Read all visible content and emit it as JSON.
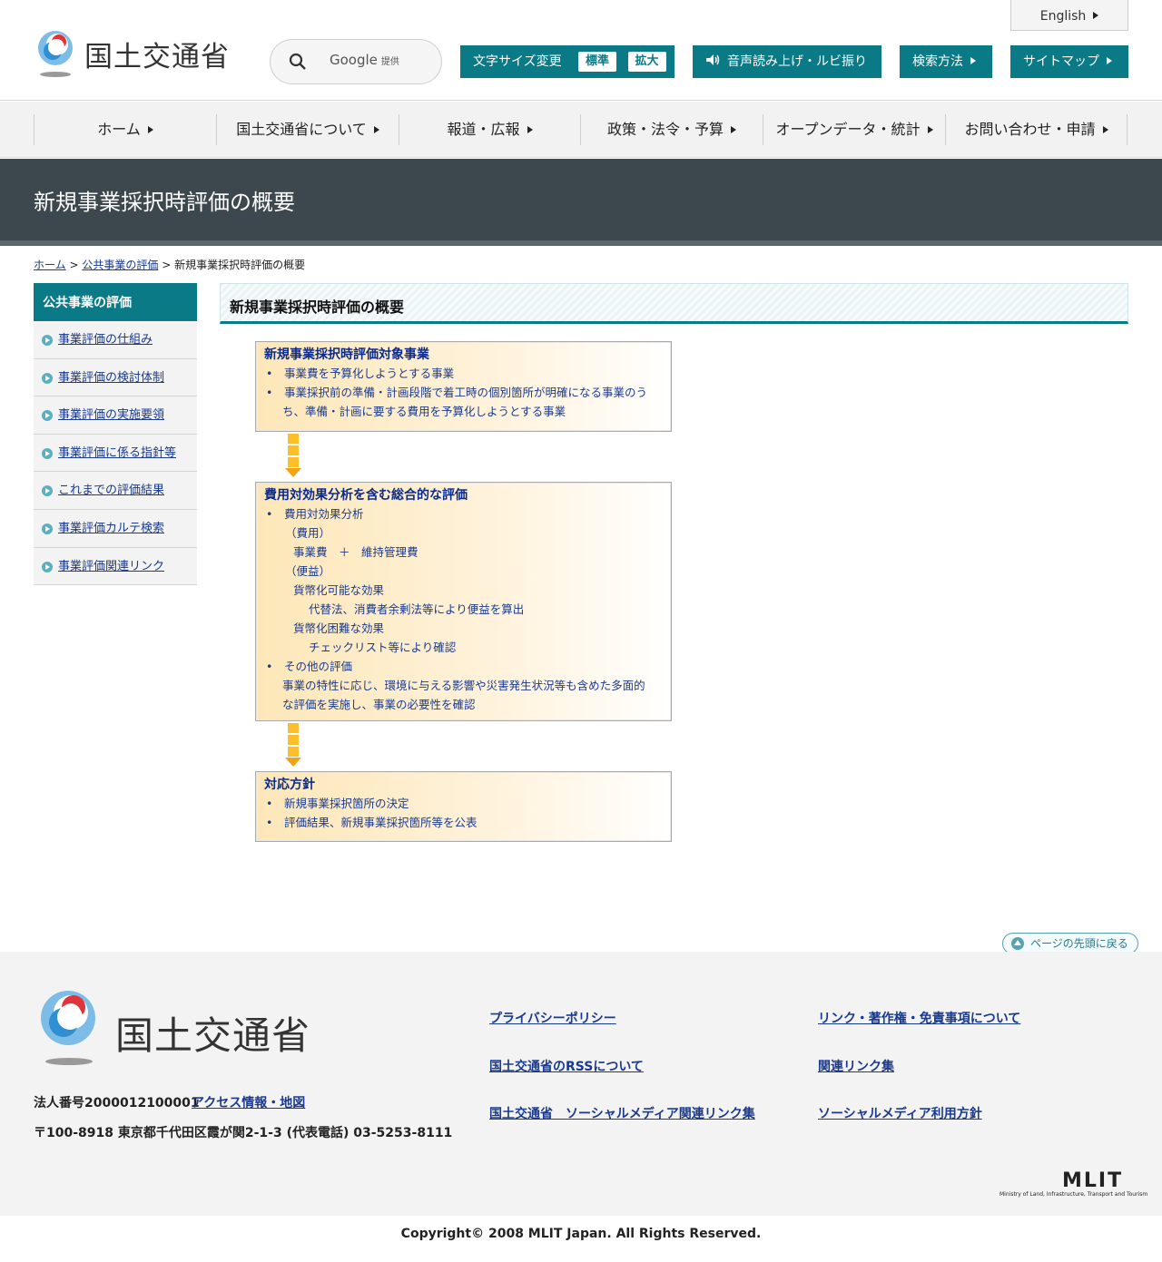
{
  "header": {
    "logo_text": "国土交通省",
    "search": {
      "provider": "Google",
      "provider_note": "提供"
    },
    "english_label": "English",
    "font_size": {
      "label": "文字サイズ変更",
      "standard": "標準",
      "large": "拡大"
    },
    "voice_label": "音声読み上げ・ルビ振り",
    "search_method_label": "検索方法",
    "sitemap_label": "サイトマップ"
  },
  "global_nav": [
    {
      "label": "ホーム"
    },
    {
      "label": "国土交通省について"
    },
    {
      "label": "報道・広報"
    },
    {
      "label": "政策・法令・予算"
    },
    {
      "label": "オープンデータ・統計"
    },
    {
      "label": "お問い合わせ・申請"
    }
  ],
  "page": {
    "title": "新規事業採択時評価の概要",
    "breadcrumb": {
      "home": "ホーム",
      "sep1": ">",
      "parent": "公共事業の評価",
      "sep2": ">",
      "current": "新規事業採択時評価の概要"
    },
    "heading": "新規事業採択時評価の概要"
  },
  "sidenav": {
    "title": "公共事業の評価",
    "items": [
      {
        "label": "事業評価の仕組み"
      },
      {
        "label": "事業評価の検討体制"
      },
      {
        "label": "事業評価の実施要領"
      },
      {
        "label": "事業評価に係る指針等"
      },
      {
        "label": "これまでの評価結果"
      },
      {
        "label": "事業評価カルテ検索"
      },
      {
        "label": "事業評価関連リンク"
      }
    ]
  },
  "flow": {
    "box1": {
      "title": "新規事業採択時評価対象事業",
      "bullet1": "事業費を予算化しようとする事業",
      "bullet2_line1": "事業採択前の準備・計画段階で着工時の個別箇所が明確になる事業のう",
      "bullet2_line2": "ち、準備・計画に要する費用を予算化しようとする事業"
    },
    "box2": {
      "title": "費用対効果分析を含む総合的な評価",
      "bullet1": "費用対効果分析",
      "cost_label": "（費用）",
      "cost_value": "事業費　＋　維持管理費",
      "benefit_label": "（便益）",
      "monetizable": "貨幣化可能な効果",
      "monetizable_detail": "代替法、消費者余剰法等により便益を算出",
      "non_monetizable": "貨幣化困難な効果",
      "non_monetizable_detail": "チェックリスト等により確認",
      "bullet2": "その他の評価",
      "other_line1": "事業の特性に応じ、環境に与える影響や災害発生状況等も含めた多面的",
      "other_line2": "な評価を実施し、事業の必要性を確認"
    },
    "box3": {
      "title": "対応方針",
      "bullet1": "新規事業採択箇所の決定",
      "bullet2": "評価結果、新規事業採択箇所等を公表"
    }
  },
  "page_top_label": "ページの先頭に戻る",
  "footer": {
    "logo_text": "国土交通省",
    "corp_number": "法人番号2000012100001",
    "access_link": "アクセス情報・地図",
    "address": "〒100-8918 東京都千代田区霞が関2-1-3 (代表電話) 03-5253-8111",
    "links": [
      {
        "label": "プライバシーポリシー"
      },
      {
        "label": "リンク・著作権・免責事項について"
      },
      {
        "label": "国土交通省のRSSについて"
      },
      {
        "label": "関連リンク集"
      },
      {
        "label": "国土交通省　ソーシャルメディア関連リンク集"
      },
      {
        "label": "ソーシャルメディア利用方針"
      }
    ],
    "mlit_mark": "MLIT",
    "mlit_tagline": "Ministry of Land, Infrastructure, Transport and Tourism",
    "copyright": "Copyright© 2008 MLIT Japan. All Rights Reserved."
  },
  "colors": {
    "accent": "#0b7a87",
    "title_band": "#3d484e",
    "link": "#1a3a8f",
    "arrow": "#fbbf2a",
    "box_gradient_start": "#fde7b8"
  }
}
